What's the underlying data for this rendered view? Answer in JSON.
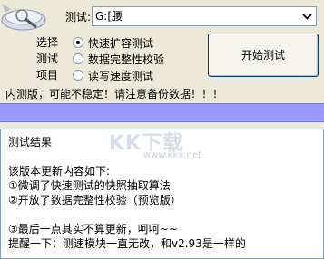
{
  "drive": {
    "label": "测试:",
    "value": "G:[腰"
  },
  "options": {
    "title_lines": [
      "选择",
      "测试",
      "项目"
    ],
    "items": [
      {
        "label": "快速扩容测试",
        "checked": true
      },
      {
        "label": "数据完整性校验",
        "checked": false
      },
      {
        "label": "读写速度测试",
        "checked": false
      }
    ]
  },
  "start_button": "开始测试",
  "warning": "内测版，可能不稳定！请注意备份数据！！！",
  "progress": 0,
  "results": {
    "title": "测试结果",
    "lines": [
      "",
      "该版本更新内容如下:",
      "①微调了快速测试的快照抽取算法",
      "②开放了数据完整性校验（预览版）",
      "",
      "③最后一点其实不算更新，呵呵~~",
      "提醒一下：测速模块一直无改，和v2.93是一样的"
    ]
  },
  "watermark": {
    "text": "KK下载",
    "url": "www.kkx.net"
  },
  "colors": {
    "progress": "#9999ff",
    "window": "#ece9d8"
  }
}
